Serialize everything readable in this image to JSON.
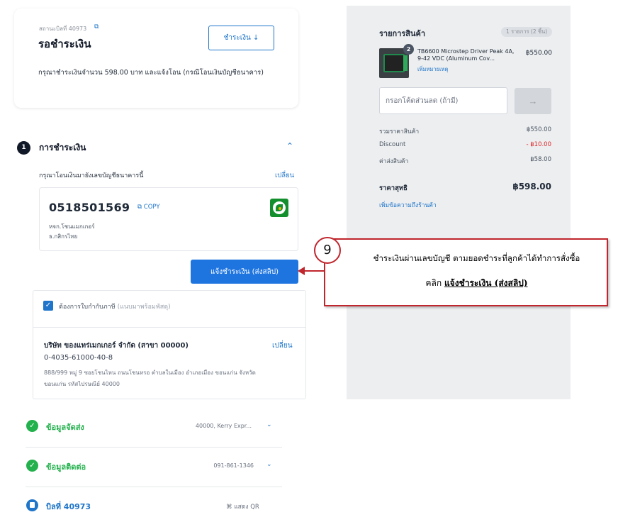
{
  "order": {
    "number_label": "สถานะบิลที่ 40973",
    "copy_glyph": "⧉",
    "status": "รอชำระเงิน",
    "pay_button": "ชำระเงิน ↓",
    "instruction": "กรุณาชำระเงินจำนวน 598.00 บาท และแจ้งโอน (กรณีโอนเงินบัญชีธนาคาร)"
  },
  "payment": {
    "step": "1",
    "title": "การชำระเงิน",
    "collapse_glyph": "⌃",
    "hint": "กรุณาโอนเงินมายังเลขบัญชีธนาคารนี้",
    "change": "เปลี่ยน",
    "account_number": "0518501569",
    "copy_label": "⧉ COPY",
    "account_name": "หจก.โชนแมกเกอร์",
    "bank_name": "ธ.กสิกรไทย",
    "notify_button": "แจ้งชำระเงิน (ส่งสลิป)"
  },
  "tax_invoice": {
    "checked_glyph": "✓",
    "label": "ต้องการใบกำกับภาษี",
    "label_note": "(แนบมาพร้อมพัสดุ)",
    "company": "บริษัท ของแทร่เมกเกอร์ จำกัด (สาขา 00000)",
    "change": "เปลี่ยน",
    "tax_id": "0-4035-61000-40-8",
    "address": "888/999 หมู่ 9 ซอยโชนไหน ถนนโชนหรอ ตำบลในเมือง อำเภอเมือง ขอนแก่น จังหวัดขอนแก่น รหัสไปรษณีย์ 40000"
  },
  "sections": {
    "shipping": {
      "icon": "✓",
      "title": "ข้อมูลจัดส่ง",
      "meta": "40000, Kerry Expr...",
      "chevron": "⌄"
    },
    "contact": {
      "icon": "✓",
      "title": "ข้อมูลติดต่อ",
      "meta": "091-861-1346",
      "chevron": "⌄"
    },
    "bill": {
      "title": "บิลที่ 40973",
      "qr": "⌘ แสดง QR"
    }
  },
  "summary": {
    "title": "รายการสินค้า",
    "count": "1 รายการ (2 ชิ้น)",
    "product": {
      "qty_badge": "2",
      "name": "TB6600 Microstep Driver Peak 4A, 9-42 VDC (Aluminum Cov...",
      "note": "เพิ่มหมายเหตุ",
      "price": "฿550.00"
    },
    "coupon_placeholder": "กรอกโค้ดส่วนลด (ถ้ามี)",
    "coupon_button": "→",
    "subtotal_label": "รวมราคาสินค้า",
    "subtotal": "฿550.00",
    "discount_label": "Discount",
    "discount": "- ฿10.00",
    "shipping_label": "ค่าส่งสินค้า",
    "shipping": "฿58.00",
    "total_label": "ราคาสุทธิ",
    "total": "฿598.00",
    "shop_note": "เพิ่มข้อความถึงร้านค้า"
  },
  "callout": {
    "number": "9",
    "line1": "ชำระเงินผ่านเลขบัญชี ตามยอดชำระที่ลูกค้าได้ทำการสั่งซื้อ",
    "line2_prefix": "คลิก ",
    "line2_strong": "แจ้งชำระเงิน (ส่งสลิป)"
  },
  "colors": {
    "accent": "#1f75c9",
    "primary_button": "#1f75e0",
    "success": "#22b14c",
    "danger": "#e02424",
    "callout_border": "#c0262d",
    "summary_bg": "#eceef0"
  }
}
